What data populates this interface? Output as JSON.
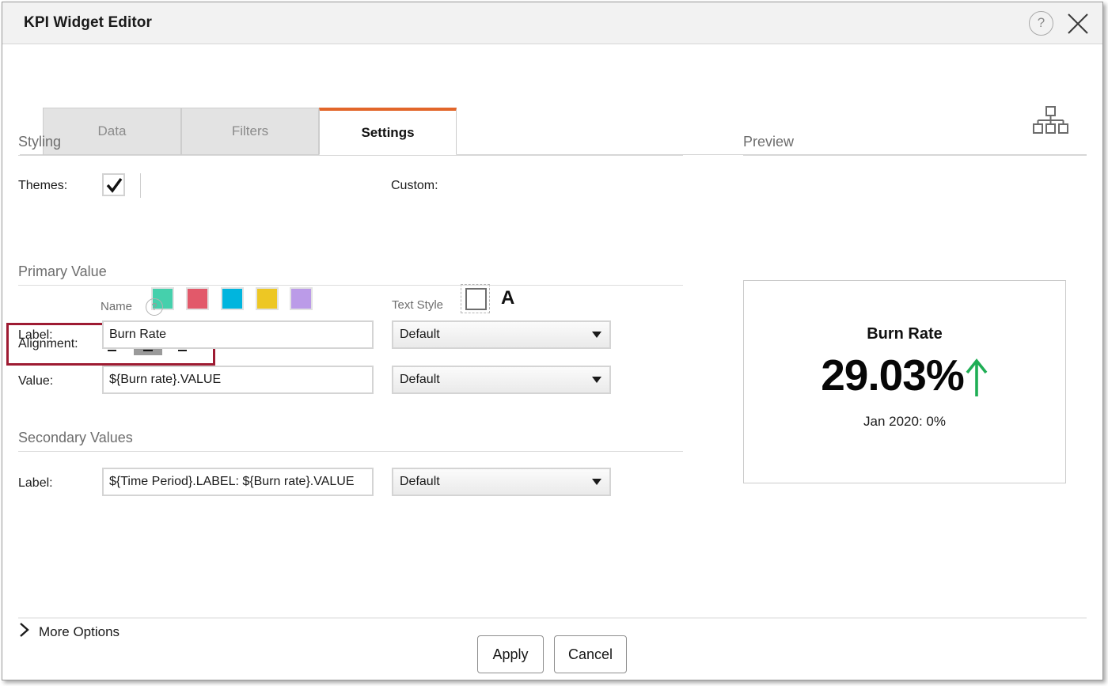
{
  "window": {
    "title": "KPI Widget Editor",
    "help_icon": "question-circle-icon",
    "close_icon": "close-icon",
    "hierarchy_icon": "hierarchy-icon"
  },
  "tabs": [
    {
      "label": "Data",
      "active": false
    },
    {
      "label": "Filters",
      "active": false
    },
    {
      "label": "Settings",
      "active": true
    }
  ],
  "accent_color": "#E2662A",
  "annotation_color": "#9E1B32",
  "styling": {
    "heading": "Styling",
    "themes_label": "Themes:",
    "themes_checked": true,
    "swatches": [
      {
        "name": "theme-teal",
        "color": "#45D0AC"
      },
      {
        "name": "theme-red",
        "color": "#E2596A"
      },
      {
        "name": "theme-cyan",
        "color": "#00B5DE"
      },
      {
        "name": "theme-yellow",
        "color": "#EDC724"
      },
      {
        "name": "theme-purple",
        "color": "#BB9BE8"
      }
    ],
    "custom_label": "Custom:",
    "custom_swatch_color": "#FFFFFF",
    "custom_text_glyph": "A",
    "alignment_label": "Alignment:",
    "alignment_options": [
      {
        "name": "align-left-icon",
        "value": "left",
        "selected": false
      },
      {
        "name": "align-center-icon",
        "value": "center",
        "selected": true
      },
      {
        "name": "align-right-icon",
        "value": "right",
        "selected": false
      }
    ]
  },
  "primary_value": {
    "heading": "Primary Value",
    "col_name_header": "Name",
    "col_textstyle_header": "Text Style",
    "label_row_label": "Label:",
    "label_value": "Burn Rate",
    "label_style": "Default",
    "value_row_label": "Value:",
    "value_value": "${Burn rate}.VALUE",
    "value_style": "Default"
  },
  "secondary_values": {
    "heading": "Secondary Values",
    "label_row_label": "Label:",
    "label_value": "${Time Period}.LABEL: ${Burn rate}.VALUE",
    "label_style": "Default"
  },
  "more_options": {
    "label": "More Options",
    "icon": "chevron-right-icon",
    "expanded": false
  },
  "preview": {
    "heading": "Preview",
    "kpi_title": "Burn Rate",
    "kpi_value": "29.03%",
    "trend_icon": "arrow-up-icon",
    "trend_color": "#1FAE55",
    "kpi_subtitle": "Jan 2020: 0%"
  },
  "footer": {
    "apply_label": "Apply",
    "cancel_label": "Cancel"
  }
}
